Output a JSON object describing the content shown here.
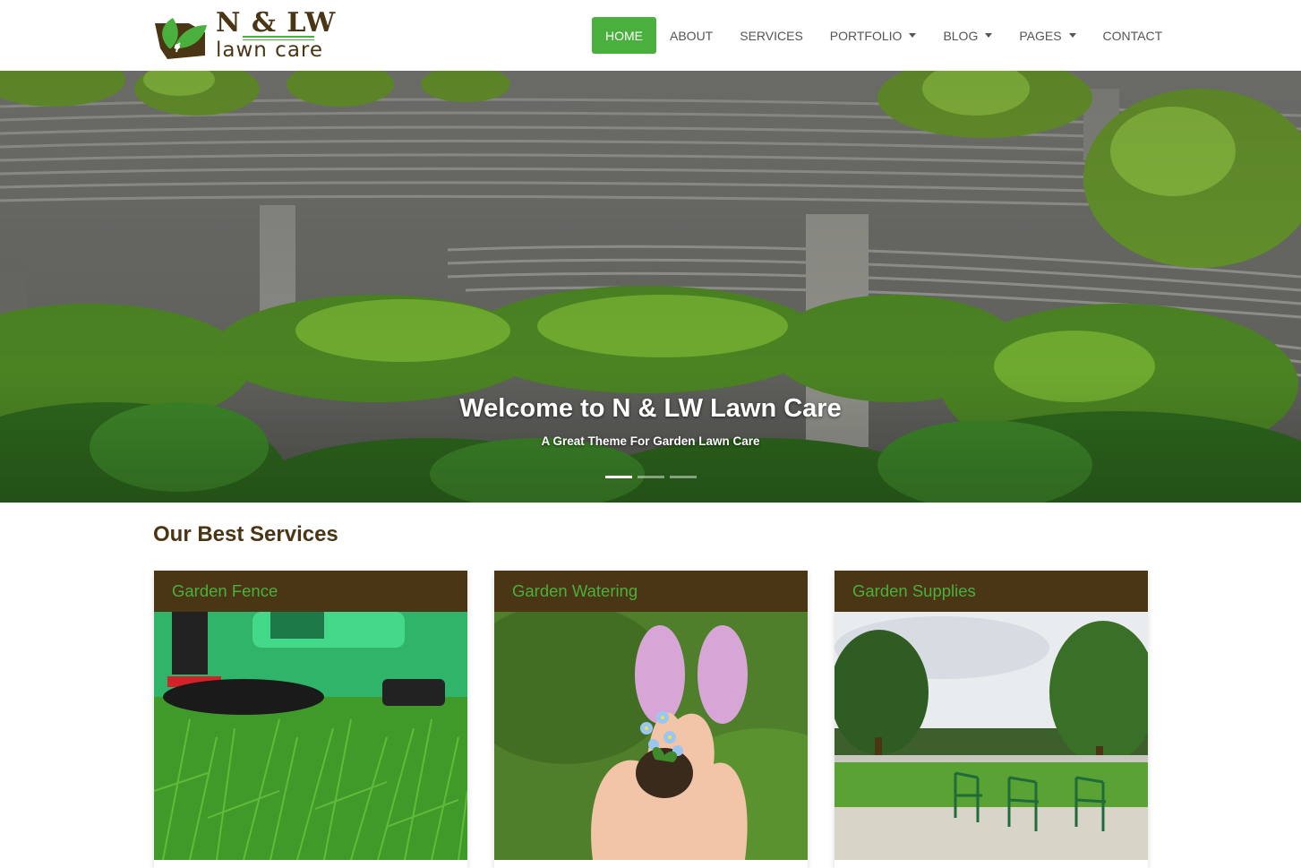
{
  "brand": {
    "title_left": "N",
    "title_amp": "&",
    "title_right": "LW",
    "subtitle": "lawn care"
  },
  "nav": {
    "items": [
      {
        "label": "HOME",
        "active": true,
        "dropdown": false
      },
      {
        "label": "ABOUT",
        "active": false,
        "dropdown": false
      },
      {
        "label": "SERVICES",
        "active": false,
        "dropdown": false
      },
      {
        "label": "PORTFOLIO",
        "active": false,
        "dropdown": true
      },
      {
        "label": "BLOG",
        "active": false,
        "dropdown": true
      },
      {
        "label": "PAGES",
        "active": false,
        "dropdown": true
      },
      {
        "label": "CONTACT",
        "active": false,
        "dropdown": false
      }
    ]
  },
  "hero": {
    "title": "Welcome to N & LW Lawn Care",
    "subtitle": "A Great Theme For Garden Lawn Care",
    "slide_count": 3,
    "active_slide": 1
  },
  "services": {
    "heading": "Our Best Services",
    "cards": [
      {
        "title": "Garden Fence"
      },
      {
        "title": "Garden Watering"
      },
      {
        "title": "Garden Supplies"
      }
    ]
  },
  "colors": {
    "accent_green": "#4ab03d",
    "brand_brown": "#4a3514"
  }
}
